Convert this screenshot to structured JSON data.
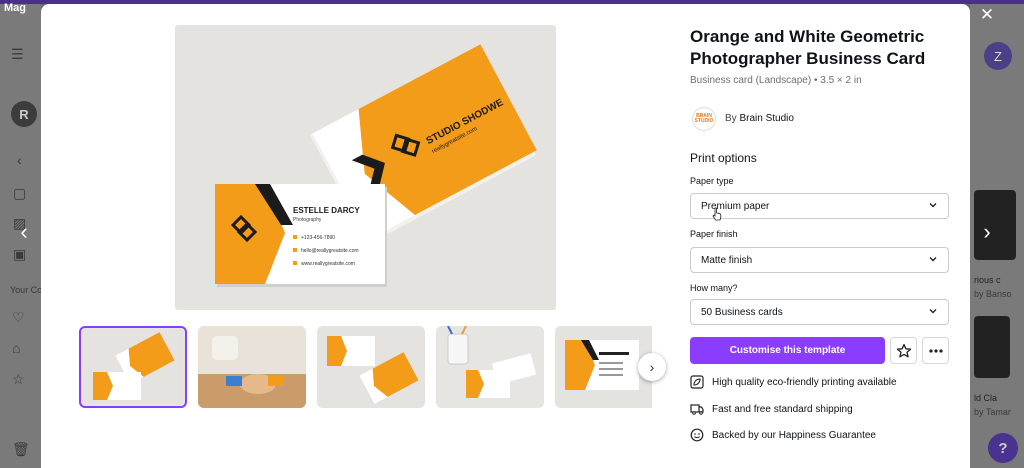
{
  "background": {
    "logo_text": "Mag",
    "left_avatar": "R",
    "right_avatar": "Z",
    "left_fragment_your": "Your Co",
    "right_fragment_1": "rious c",
    "right_fragment_2": "by Banso",
    "right_fragment_3": "ld Cla",
    "right_fragment_4": "by Tamar",
    "help": "?"
  },
  "template": {
    "title": "Orange and White Geometric Photographer Business Card",
    "subtitle": "Business card (Landscape) • 3.5 × 2 in",
    "author_prefix": "By",
    "author_name": "Brain Studio",
    "author_logo_text": "BRAIN STUDIO"
  },
  "preview": {
    "back_card_name": "STUDIO SHODWE",
    "back_card_site": "reallygreatsite.com",
    "front_card_name": "ESTELLE DARCY",
    "front_card_role": "Photography",
    "phone": "+123-456-7890",
    "email": "hello@reallygreatsite.com",
    "website": "www.reallygreatsite.com"
  },
  "print_options": {
    "heading": "Print options",
    "paper_type_label": "Paper type",
    "paper_type_value": "Premium paper",
    "paper_finish_label": "Paper finish",
    "paper_finish_value": "Matte finish",
    "quantity_label": "How many?",
    "quantity_value": "50 Business cards"
  },
  "actions": {
    "customise_label": "Customise this template"
  },
  "features": [
    {
      "icon": "leaf-icon",
      "text": "High quality eco-friendly printing available"
    },
    {
      "icon": "truck-icon",
      "text": "Fast and free standard shipping"
    },
    {
      "icon": "smile-icon",
      "text": "Backed by our Happiness Guarantee"
    }
  ],
  "colors": {
    "accent": "#8b3dff",
    "card_orange": "#f39c1a",
    "card_black": "#1b1b1b"
  }
}
